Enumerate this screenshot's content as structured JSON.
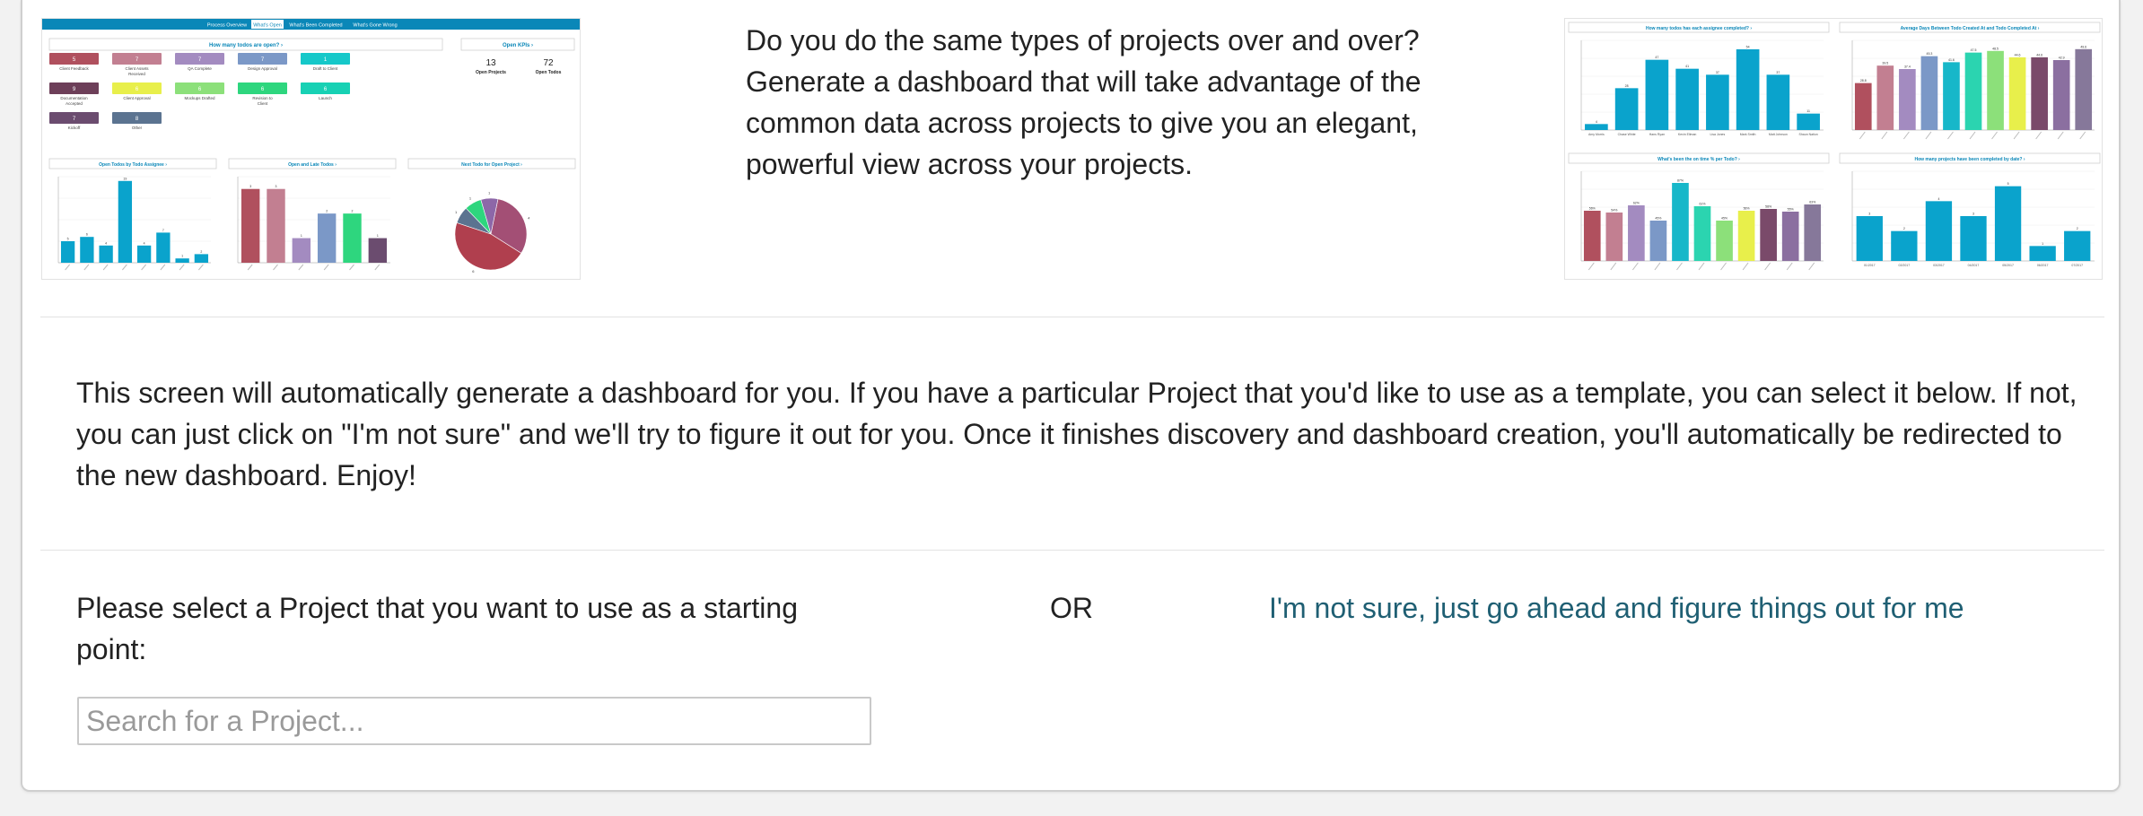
{
  "thumb_left": {
    "tabs": [
      "Process Overview",
      "What's Open",
      "What's Been Completed",
      "What's Gone Wrong"
    ],
    "section_open_todos": "How many todos are open? ›",
    "section_open_kpis": "Open KPIs ›",
    "kpi_open_projects": {
      "value": "13",
      "label": "Open Projects"
    },
    "kpi_open_todos": {
      "value": "72",
      "label": "Open Todos"
    },
    "status_boxes": [
      {
        "value": "5",
        "label": "Client Feedback",
        "color": "#b0505e"
      },
      {
        "value": "7",
        "label": "Client Assets Received",
        "color": "#c27f91"
      },
      {
        "value": "7",
        "label": "QA Complete",
        "color": "#a38bc0"
      },
      {
        "value": "7",
        "label": "Design Approval",
        "color": "#7b98c7"
      },
      {
        "value": "1",
        "label": "Draft to Client",
        "color": "#16c8c9"
      },
      {
        "value": "9",
        "label": "Documentation Accepted",
        "color": "#6d3f59"
      },
      {
        "value": "6",
        "label": "Client Approval",
        "color": "#e8ef4b"
      },
      {
        "value": "6",
        "label": "Mockups Drafted",
        "color": "#8ce07a"
      },
      {
        "value": "6",
        "label": "Revision to Client",
        "color": "#2ed67e"
      },
      {
        "value": "6",
        "label": "Launch",
        "color": "#17d1b4"
      },
      {
        "value": "7",
        "label": "Kickoff",
        "color": "#6b4c6f"
      },
      {
        "value": "8",
        "label": "Other",
        "color": "#5b7390"
      }
    ],
    "chart_titles": [
      "Open Todos by Todo Assignee ›",
      "Open and Late Todos ›",
      "Next Todo for Open Project ›"
    ]
  },
  "intro_text": "Do you do the same types of projects over and over? Generate a dashboard that will take advantage of the common data across projects to give you an elegant, powerful view across your projects.",
  "thumb_right": {
    "chart_titles": [
      "How many todos has each assignee completed? ›",
      "Average Days Between Todo Created At and Todo Completed At ›",
      "What's been the on time % per Todo? ›",
      "How many projects have been completed by date? ›"
    ]
  },
  "chart_data": [
    {
      "type": "bar",
      "title": "Open Todos by Todo Assignee ›",
      "values": [
        5,
        6,
        4,
        19,
        4,
        7,
        1,
        2
      ]
    },
    {
      "type": "bar",
      "title": "Open and Late Todos ›",
      "values": [
        3,
        3,
        1,
        2,
        2,
        1
      ]
    },
    {
      "type": "pie",
      "title": "Next Todo for Open Project ›",
      "values": [
        4,
        6,
        1,
        1,
        1
      ]
    },
    {
      "type": "bar",
      "title": "How many todos has each assignee completed? ›",
      "categories": [
        "Amy Morris",
        "Chase White",
        "Hans Ryan",
        "Kevin Ellman",
        "Lisa Jones",
        "Mark Smith",
        "Matt Johnson",
        "Shaun Nation"
      ],
      "values": [
        4,
        28,
        47,
        41,
        37,
        54,
        37,
        11
      ]
    },
    {
      "type": "bar",
      "title": "Average Days Between Todo Created At and Todo Completed At ›",
      "values": [
        28.8,
        39.5,
        37.4,
        45.3,
        41.6,
        47.5,
        48.5,
        44.6,
        44.6,
        42.9,
        49.6
      ]
    },
    {
      "type": "bar",
      "title": "What's been the on time % per Todo? ›",
      "values": [
        56,
        54,
        62,
        45,
        87,
        61,
        45,
        56,
        58,
        55,
        63
      ]
    },
    {
      "type": "bar",
      "title": "How many projects have been completed by date? ›",
      "categories": [
        "01/2017",
        "02/2017",
        "03/2017",
        "04/2017",
        "05/2017",
        "06/2017",
        "07/2017"
      ],
      "values": [
        3,
        2,
        4,
        3,
        5,
        1,
        2
      ]
    }
  ],
  "description": "This screen will automatically generate a dashboard for you. If you have a particular Project that you'd like to use as a template, you can select it below. If not, you can just click on \"I'm not sure\" and we'll try to figure it out for you. Once it finishes discovery and dashboard creation, you'll automatically be redirected to the new dashboard. Enjoy!",
  "select_label": "Please select a Project that you want to use as a starting point:",
  "or_label": "OR",
  "not_sure_link": "I'm not sure, just go ahead and figure things out for me",
  "search": {
    "placeholder": "Search for a Project..."
  },
  "colors": {
    "bar_blue": "#0aa3cc",
    "link": "#1f5f73",
    "tab_bar": "#0a87b8"
  }
}
